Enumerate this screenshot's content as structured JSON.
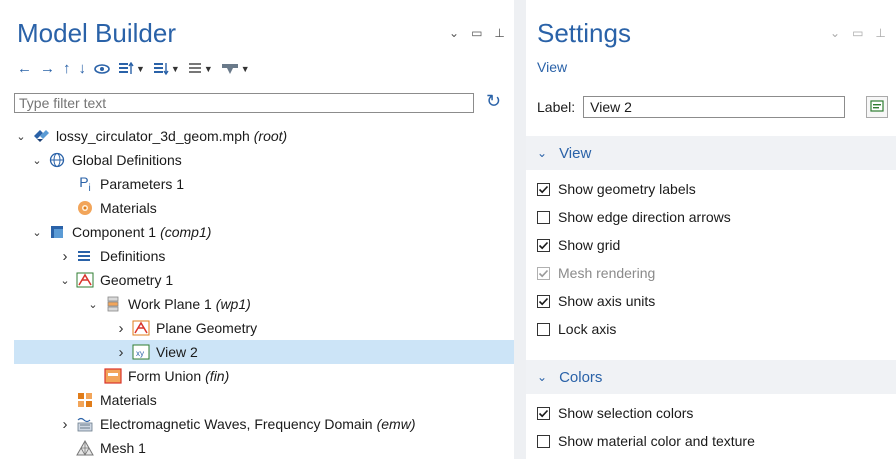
{
  "model_builder": {
    "title": "Model Builder",
    "filter_placeholder": "Type filter text",
    "tree": [
      {
        "label": "lossy_circulator_3d_geom.mph",
        "tag": "(root)",
        "expander": "down",
        "icon": "comsol-model-icon"
      },
      {
        "label": "Global Definitions",
        "tag": "",
        "expander": "down",
        "icon": "globe-icon"
      },
      {
        "label": "Parameters 1",
        "tag": "",
        "expander": "",
        "icon": "parameters-icon",
        "icon_text": "Pi"
      },
      {
        "label": "Materials",
        "tag": "",
        "expander": "",
        "icon": "materials-icon"
      },
      {
        "label": "Component 1",
        "tag": "(comp1)",
        "expander": "down",
        "icon": "component-icon"
      },
      {
        "label": "Definitions",
        "tag": "",
        "expander": "right",
        "icon": "definitions-icon"
      },
      {
        "label": "Geometry 1",
        "tag": "",
        "expander": "down",
        "icon": "geometry-icon"
      },
      {
        "label": "Work Plane 1",
        "tag": "(wp1)",
        "expander": "down",
        "icon": "work-plane-icon"
      },
      {
        "label": "Plane Geometry",
        "tag": "",
        "expander": "right",
        "icon": "plane-geometry-icon"
      },
      {
        "label": "View 2",
        "tag": "",
        "expander": "right",
        "icon": "view-icon",
        "icon_text": "xy",
        "selected": true
      },
      {
        "label": "Form Union",
        "tag": "(fin)",
        "expander": "",
        "icon": "form-union-icon"
      },
      {
        "label": "Materials",
        "tag": "",
        "expander": "",
        "icon": "materials-node-icon"
      },
      {
        "label": "Electromagnetic Waves, Frequency Domain",
        "tag": "(emw)",
        "expander": "right",
        "icon": "emw-physics-icon"
      },
      {
        "label": "Mesh 1",
        "tag": "",
        "expander": "",
        "icon": "mesh-icon"
      }
    ]
  },
  "settings": {
    "title": "Settings",
    "subtitle": "View",
    "label_caption": "Label:",
    "label_value": "View 2",
    "view_section": {
      "title": "View",
      "options": [
        {
          "label": "Show geometry labels",
          "checked": true,
          "disabled": false
        },
        {
          "label": "Show edge direction arrows",
          "checked": false,
          "disabled": false
        },
        {
          "label": "Show grid",
          "checked": true,
          "disabled": false
        },
        {
          "label": "Mesh rendering",
          "checked": true,
          "disabled": true
        },
        {
          "label": "Show axis units",
          "checked": true,
          "disabled": false
        },
        {
          "label": "Lock axis",
          "checked": false,
          "disabled": false
        }
      ]
    },
    "colors_section": {
      "title": "Colors",
      "options": [
        {
          "label": "Show selection colors",
          "checked": true,
          "disabled": false
        },
        {
          "label": "Show material color and texture",
          "checked": false,
          "disabled": false
        }
      ]
    }
  },
  "colors": {
    "accent": "#2a62a8",
    "selection": "#cce4f7",
    "section_bg": "#f0f2f5"
  }
}
